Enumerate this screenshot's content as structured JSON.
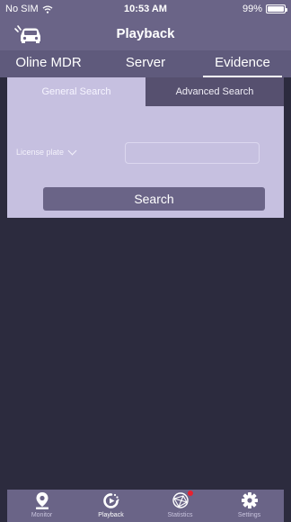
{
  "status_bar": {
    "carrier": "No SIM",
    "time": "10:53 AM",
    "battery": "99%"
  },
  "nav_bar": {
    "title": "Playback"
  },
  "top_tabs": [
    {
      "label": "Oline MDR",
      "active": false
    },
    {
      "label": "Server",
      "active": false
    },
    {
      "label": "Evidence",
      "active": true
    }
  ],
  "sub_tabs": [
    {
      "label": "General Search",
      "active": true
    },
    {
      "label": "Advanced Search",
      "active": false
    }
  ],
  "filter": {
    "field_label": "License plate",
    "input_value": "",
    "input_placeholder": ""
  },
  "search_button": "Search",
  "tab_bar": [
    {
      "label": "Monitor",
      "icon": "map-pin-icon",
      "active": false
    },
    {
      "label": "Playback",
      "icon": "playback-icon",
      "active": true
    },
    {
      "label": "Statistics",
      "icon": "statistics-icon",
      "active": false,
      "badge": true
    },
    {
      "label": "Settings",
      "icon": "gear-icon",
      "active": false
    }
  ],
  "colors": {
    "header": "#6a6487",
    "panel": "#c6c0e0",
    "background": "#2c2b3e",
    "badge": "#e8202e"
  }
}
